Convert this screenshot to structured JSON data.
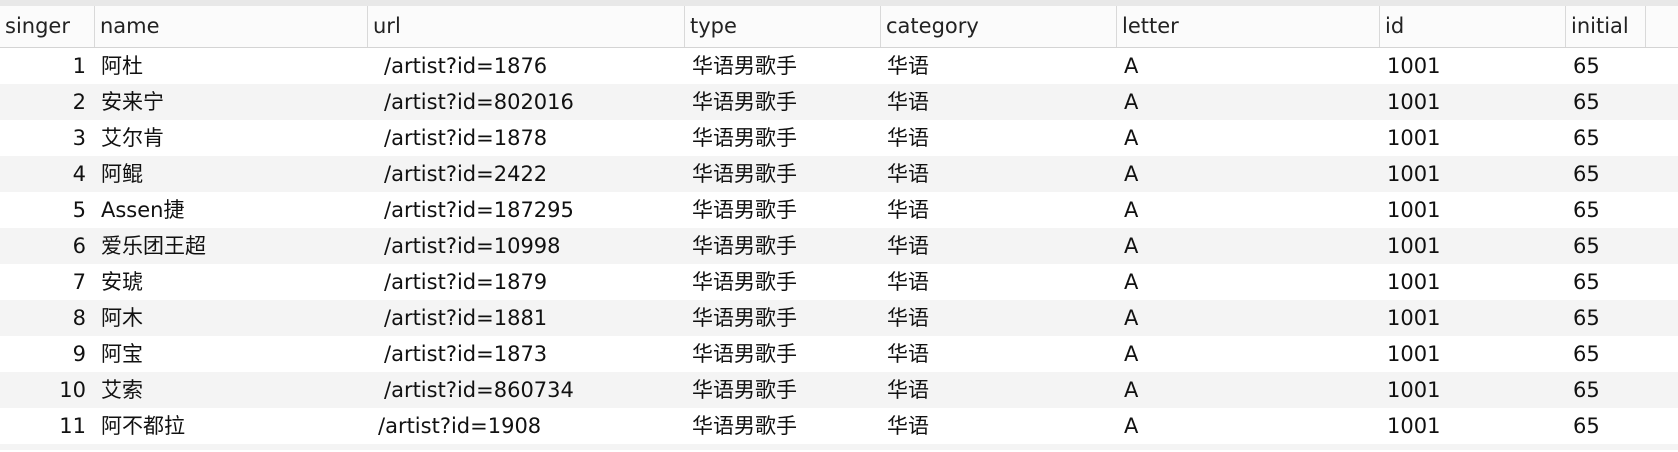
{
  "table": {
    "columns": [
      "singer",
      "name",
      "url",
      "type",
      "category",
      "letter",
      "id",
      "initial"
    ],
    "rows": [
      {
        "singer": "1",
        "name": "阿杜",
        "url": "/artist?id=1876",
        "type": "华语男歌手",
        "category": "华语",
        "letter": "A",
        "id": "1001",
        "initial": "65"
      },
      {
        "singer": "2",
        "name": "安来宁",
        "url": "/artist?id=802016",
        "type": "华语男歌手",
        "category": "华语",
        "letter": "A",
        "id": "1001",
        "initial": "65"
      },
      {
        "singer": "3",
        "name": "艾尔肯",
        "url": "/artist?id=1878",
        "type": "华语男歌手",
        "category": "华语",
        "letter": "A",
        "id": "1001",
        "initial": "65"
      },
      {
        "singer": "4",
        "name": "阿鲲",
        "url": "/artist?id=2422",
        "type": "华语男歌手",
        "category": "华语",
        "letter": "A",
        "id": "1001",
        "initial": "65"
      },
      {
        "singer": "5",
        "name": "Assen捷",
        "url": "/artist?id=187295",
        "type": "华语男歌手",
        "category": "华语",
        "letter": "A",
        "id": "1001",
        "initial": "65"
      },
      {
        "singer": "6",
        "name": "爱乐团王超",
        "url": "/artist?id=10998",
        "type": "华语男歌手",
        "category": "华语",
        "letter": "A",
        "id": "1001",
        "initial": "65"
      },
      {
        "singer": "7",
        "name": "安琥",
        "url": "/artist?id=1879",
        "type": "华语男歌手",
        "category": "华语",
        "letter": "A",
        "id": "1001",
        "initial": "65"
      },
      {
        "singer": "8",
        "name": "阿木",
        "url": "/artist?id=1881",
        "type": "华语男歌手",
        "category": "华语",
        "letter": "A",
        "id": "1001",
        "initial": "65"
      },
      {
        "singer": "9",
        "name": "阿宝",
        "url": "/artist?id=1873",
        "type": "华语男歌手",
        "category": "华语",
        "letter": "A",
        "id": "1001",
        "initial": "65"
      },
      {
        "singer": "10",
        "name": "艾索",
        "url": "/artist?id=860734",
        "type": "华语男歌手",
        "category": "华语",
        "letter": "A",
        "id": "1001",
        "initial": "65"
      },
      {
        "singer": "11",
        "name": "阿不都拉",
        "url": "/artist?id=1908",
        "type": "华语男歌手",
        "category": "华语",
        "letter": "A",
        "id": "1001",
        "initial": "65"
      }
    ]
  }
}
